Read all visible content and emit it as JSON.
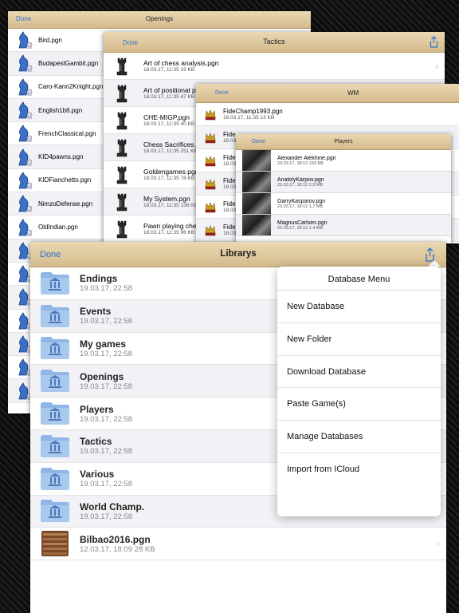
{
  "openings": {
    "done": "Done",
    "title": "Openings",
    "files": [
      "Bird.pgn",
      "BudapestGambit.pgn",
      "Caro-Kann2Knight.pgn",
      "English1b6.pgn",
      "FrenchClassical.pgn",
      "KID4pawns.pgn",
      "KIDFianchetto.pgn",
      "NimzoDefense.pgn",
      "OldIndian.pgn"
    ]
  },
  "tactics": {
    "done": "Done",
    "title": "Tactics",
    "files": [
      {
        "name": "Art of chess analysis.pgn",
        "meta": "18.03.17, 11:35  19 KB"
      },
      {
        "name": "Art of positional play.pgn",
        "meta": "18.03.17, 11:35  47 KB"
      },
      {
        "name": "CHE-MIGP.pgn",
        "meta": "18.03.17, 11:35  40 KB"
      },
      {
        "name": "Chess Sacrifices.pgn",
        "meta": "18.03.17, 11:35  251 KB"
      },
      {
        "name": "Goldengames.pgn",
        "meta": "18.03.17, 11:35  78 KB"
      },
      {
        "name": "My System.pgn",
        "meta": "18.03.17, 11:35  136 KB"
      },
      {
        "name": "Pawn playing chess.pgn",
        "meta": "18.03.17, 11:35  96 KB"
      }
    ]
  },
  "fide": {
    "done": "Done",
    "title": "WM",
    "files": [
      {
        "name": "FideChamp1993.pgn",
        "meta": "18.03.17, 11:35  13 KB"
      },
      {
        "name": "Fide",
        "meta": "18.03.17"
      },
      {
        "name": "Fide",
        "meta": "18.03.17"
      },
      {
        "name": "Fide",
        "meta": "18.03.17"
      },
      {
        "name": "Fide",
        "meta": "18.03.17"
      },
      {
        "name": "Fide",
        "meta": "18.03.17"
      }
    ]
  },
  "players": {
    "done": "Done",
    "title": "Players",
    "files": [
      {
        "name": "Alexander Alekhine.pgn",
        "meta": "23.03.17, 18:12  153 KB"
      },
      {
        "name": "AnatolyKarpov.pgn",
        "meta": "23.03.17, 18:12  2.5 MB"
      },
      {
        "name": "GarryKasparov.pgn",
        "meta": "23.03.17, 18:12  1.7 MB"
      },
      {
        "name": "MagnusCarlsen.pgn",
        "meta": "23.03.17, 18:12  1.4 MB"
      }
    ]
  },
  "library": {
    "done": "Done",
    "title": "Librarys",
    "folders": [
      {
        "name": "Endings",
        "date": "19.03.17, 22:58"
      },
      {
        "name": "Events",
        "date": "19.03.17, 22:58"
      },
      {
        "name": "My games",
        "date": "19.03.17, 22:58"
      },
      {
        "name": "Openings",
        "date": "19.03.17, 22:58"
      },
      {
        "name": "Players",
        "date": "19.03.17, 22:58"
      },
      {
        "name": "Tactics",
        "date": "19.03.17, 22:58"
      },
      {
        "name": "Various",
        "date": "19.03.17, 22:58"
      },
      {
        "name": "World Champ.",
        "date": "19.03.17, 22:58"
      }
    ],
    "file": {
      "name": "Bilbao2016.pgn",
      "meta": "12.03.17, 18:09  28 KB"
    }
  },
  "menu": {
    "title": "Database Menu",
    "items": [
      "New Database",
      "New Folder",
      "Download Database",
      "Paste Game(s)",
      "Manage Databases",
      "Import from ICloud"
    ]
  },
  "colors": {
    "accent": "#2f6fd0",
    "folder": "#8fb6e6",
    "parchment": "#e2cfa6"
  },
  "icons": {
    "opening": "knight-pawn-icon",
    "tactics": "rook-icon",
    "fide": "crown-icon",
    "folder": "folder-icon",
    "database": "books-icon",
    "share": "share-icon",
    "chevron": "chevron-right-icon"
  }
}
